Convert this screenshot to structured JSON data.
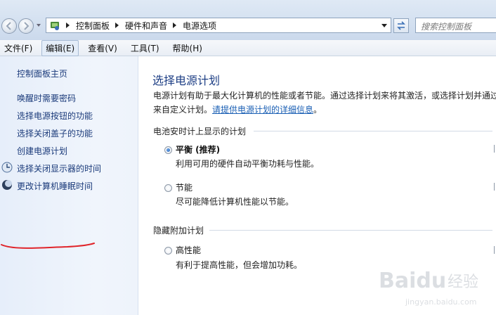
{
  "breadcrumb": [
    "控制面板",
    "硬件和声音",
    "电源选项"
  ],
  "search": {
    "placeholder": "搜索控制面板"
  },
  "menu": [
    "文件(F)",
    "编辑(E)",
    "查看(V)",
    "工具(T)",
    "帮助(H)"
  ],
  "sidebar": {
    "home": "控制面板主页",
    "links": [
      "唤醒时需要密码",
      "选择电源按钮的功能",
      "选择关闭盖子的功能",
      "创建电源计划",
      "选择关闭显示器的时间",
      "更改计算机睡眠时间"
    ]
  },
  "main": {
    "title": "选择电源计划",
    "desc_line1": "电源计划有助于最大化计算机的性能或者节能。通过选择计划来将其激活，或选择计划并通过",
    "desc_line2_prefix": "来自定义计划。",
    "desc_link": "请提供电源计划的详细信息",
    "desc_line2_suffix": "。",
    "battery_group": "电池安时计上显示的计划",
    "hidden_group": "隐藏附加计划",
    "plans": [
      {
        "name": "平衡 (推荐)",
        "desc": "利用可用的硬件自动平衡功耗与性能。",
        "selected": true
      },
      {
        "name": "节能",
        "desc": "尽可能降低计算机性能以节能。",
        "selected": false
      },
      {
        "name": "高性能",
        "desc": "有利于提高性能，但会增加功耗。",
        "selected": false
      }
    ]
  },
  "watermark": {
    "logo": "Baidu",
    "suffix": "经验",
    "url": "jingyan.baidu.com"
  },
  "colors": {
    "link": "#1a3a7a",
    "title": "#1e3f85",
    "annotation": "#e0242a"
  }
}
